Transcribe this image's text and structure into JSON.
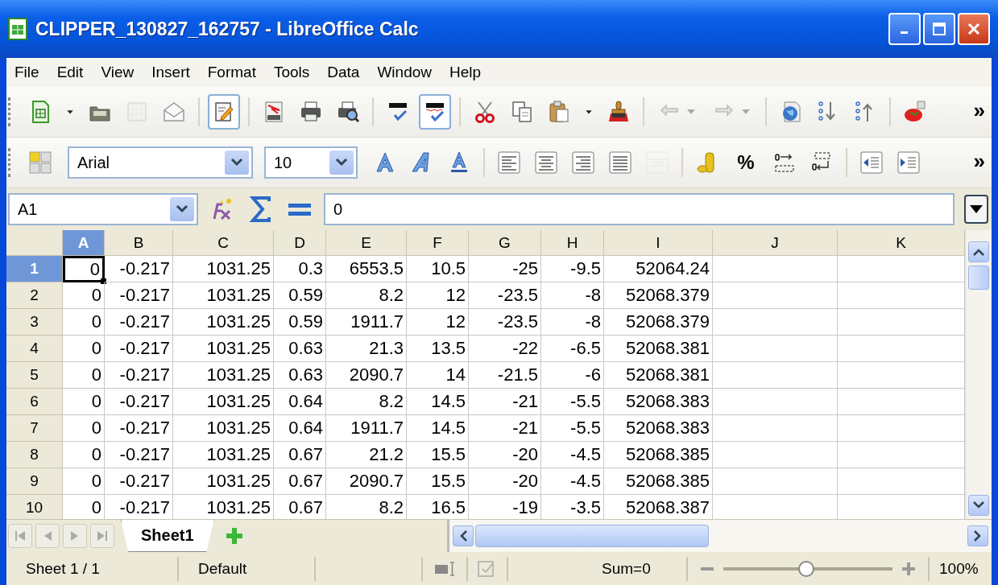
{
  "window": {
    "title": "CLIPPER_130827_162757 - LibreOffice Calc"
  },
  "menu": [
    {
      "label": "File"
    },
    {
      "label": "Edit"
    },
    {
      "label": "View"
    },
    {
      "label": "Insert"
    },
    {
      "label": "Format"
    },
    {
      "label": "Tools"
    },
    {
      "label": "Data"
    },
    {
      "label": "Window"
    },
    {
      "label": "Help"
    }
  ],
  "toolbar_standard": [
    {
      "kind": "new",
      "disabled": false,
      "on": false
    },
    {
      "kind": "dropdown"
    },
    {
      "kind": "open",
      "disabled": false,
      "on": false
    },
    {
      "kind": "save",
      "disabled": true,
      "on": false
    },
    {
      "kind": "email",
      "disabled": false,
      "on": false
    },
    {
      "kind": "separator"
    },
    {
      "kind": "edit-file",
      "disabled": false,
      "on": true
    },
    {
      "kind": "separator"
    },
    {
      "kind": "pdf",
      "disabled": false,
      "on": false
    },
    {
      "kind": "print",
      "disabled": false,
      "on": false
    },
    {
      "kind": "preview",
      "disabled": false,
      "on": false
    },
    {
      "kind": "separator"
    },
    {
      "kind": "spellcheck",
      "disabled": false,
      "on": false
    },
    {
      "kind": "autospell",
      "disabled": false,
      "on": true
    },
    {
      "kind": "separator"
    },
    {
      "kind": "cut",
      "disabled": false,
      "on": false
    },
    {
      "kind": "copy",
      "disabled": false,
      "on": false
    },
    {
      "kind": "paste",
      "disabled": false,
      "on": false
    },
    {
      "kind": "dropdown"
    },
    {
      "kind": "brush",
      "disabled": false,
      "on": false
    },
    {
      "kind": "separator"
    },
    {
      "kind": "undo",
      "disabled": true,
      "on": false
    },
    {
      "kind": "redo",
      "disabled": true,
      "on": false
    },
    {
      "kind": "separator"
    },
    {
      "kind": "navigator",
      "disabled": false,
      "on": false
    },
    {
      "kind": "sort-asc",
      "disabled": false,
      "on": false
    },
    {
      "kind": "sort-desc",
      "disabled": false,
      "on": false
    },
    {
      "kind": "separator"
    },
    {
      "kind": "chart",
      "disabled": false,
      "on": false
    }
  ],
  "toolbar_standard_more": "»",
  "toolbar_formatting": {
    "font_name": "Arial",
    "font_size": "10",
    "percent": "%",
    "more": "»",
    "buttons": [
      {
        "kind": "bold",
        "disabled": false
      },
      {
        "kind": "italic",
        "disabled": false
      },
      {
        "kind": "underline",
        "disabled": false
      },
      {
        "kind": "separator"
      },
      {
        "kind": "align-left",
        "disabled": false
      },
      {
        "kind": "align-center",
        "disabled": false
      },
      {
        "kind": "align-right",
        "disabled": false
      },
      {
        "kind": "justify",
        "disabled": false
      },
      {
        "kind": "merge",
        "disabled": true
      },
      {
        "kind": "separator"
      },
      {
        "kind": "currency",
        "disabled": false
      },
      {
        "kind": "percent"
      },
      {
        "kind": "add-decimal",
        "disabled": false
      },
      {
        "kind": "delete-decimal",
        "disabled": false
      },
      {
        "kind": "separator"
      },
      {
        "kind": "indent-decrease",
        "disabled": false
      },
      {
        "kind": "indent-increase",
        "disabled": false
      }
    ]
  },
  "formula_bar": {
    "name_box": "A1",
    "value": "0"
  },
  "sheet": {
    "columns": [
      {
        "label": "A",
        "selected": true
      },
      {
        "label": "B",
        "selected": false
      },
      {
        "label": "C",
        "selected": false
      },
      {
        "label": "D",
        "selected": false
      },
      {
        "label": "E",
        "selected": false
      },
      {
        "label": "F",
        "selected": false
      },
      {
        "label": "G",
        "selected": false
      },
      {
        "label": "H",
        "selected": false
      },
      {
        "label": "I",
        "selected": false
      },
      {
        "label": "J",
        "selected": false
      },
      {
        "label": "K",
        "selected": false
      }
    ],
    "rows": [
      {
        "label": "1",
        "selected": true,
        "cells": [
          "0",
          "-0.217",
          "1031.25",
          "0.3",
          "6553.5",
          "10.5",
          "-25",
          "-9.5",
          "52064.24"
        ]
      },
      {
        "label": "2",
        "selected": false,
        "cells": [
          "0",
          "-0.217",
          "1031.25",
          "0.59",
          "8.2",
          "12",
          "-23.5",
          "-8",
          "52068.379"
        ]
      },
      {
        "label": "3",
        "selected": false,
        "cells": [
          "0",
          "-0.217",
          "1031.25",
          "0.59",
          "1911.7",
          "12",
          "-23.5",
          "-8",
          "52068.379"
        ]
      },
      {
        "label": "4",
        "selected": false,
        "cells": [
          "0",
          "-0.217",
          "1031.25",
          "0.63",
          "21.3",
          "13.5",
          "-22",
          "-6.5",
          "52068.381"
        ]
      },
      {
        "label": "5",
        "selected": false,
        "cells": [
          "0",
          "-0.217",
          "1031.25",
          "0.63",
          "2090.7",
          "14",
          "-21.5",
          "-6",
          "52068.381"
        ]
      },
      {
        "label": "6",
        "selected": false,
        "cells": [
          "0",
          "-0.217",
          "1031.25",
          "0.64",
          "8.2",
          "14.5",
          "-21",
          "-5.5",
          "52068.383"
        ]
      },
      {
        "label": "7",
        "selected": false,
        "cells": [
          "0",
          "-0.217",
          "1031.25",
          "0.64",
          "1911.7",
          "14.5",
          "-21",
          "-5.5",
          "52068.383"
        ]
      },
      {
        "label": "8",
        "selected": false,
        "cells": [
          "0",
          "-0.217",
          "1031.25",
          "0.67",
          "21.2",
          "15.5",
          "-20",
          "-4.5",
          "52068.385"
        ]
      },
      {
        "label": "9",
        "selected": false,
        "cells": [
          "0",
          "-0.217",
          "1031.25",
          "0.67",
          "2090.7",
          "15.5",
          "-20",
          "-4.5",
          "52068.385"
        ]
      },
      {
        "label": "10",
        "selected": false,
        "cells": [
          "0",
          "-0.217",
          "1031.25",
          "0.67",
          "8.2",
          "16.5",
          "-19",
          "-3.5",
          "52068.387"
        ]
      }
    ]
  },
  "sheet_tabs": [
    {
      "label": "Sheet1",
      "selected": true
    }
  ],
  "status_bar": {
    "sheet": "Sheet 1 / 1",
    "page_style": "Default",
    "sum": "Sum=0",
    "zoom": {
      "level": 0.49,
      "reading": "100%"
    }
  }
}
